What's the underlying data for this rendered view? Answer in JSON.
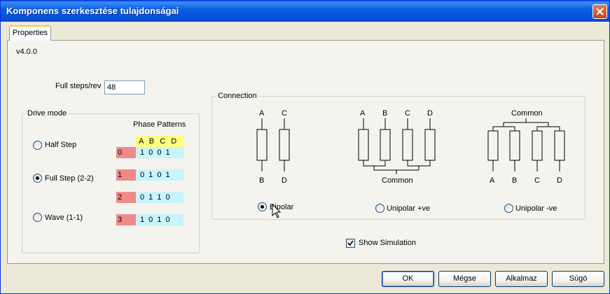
{
  "window": {
    "title": "Komponens szerkesztése tulajdonságai"
  },
  "tabs": [
    {
      "label": "Properties"
    }
  ],
  "version": "v4.0.0",
  "full_steps": {
    "label": "Full steps/rev",
    "value": "48"
  },
  "drive_mode": {
    "title": "Drive mode",
    "options": [
      {
        "label": "Half Step",
        "selected": false
      },
      {
        "label": "Full Step (2-2)",
        "selected": true
      },
      {
        "label": "Wave (1-1)",
        "selected": false
      }
    ],
    "phase_patterns": {
      "title": "Phase Patterns",
      "headers": [
        "A",
        "B",
        "C",
        "D"
      ],
      "rows": [
        {
          "index": "0",
          "bits": "1 0 0 1"
        },
        {
          "index": "1",
          "bits": "0 1 0 1"
        },
        {
          "index": "2",
          "bits": "0 1 1 0"
        },
        {
          "index": "3",
          "bits": "1 0 1 0"
        }
      ]
    }
  },
  "connection": {
    "title": "Connection",
    "bipolar": {
      "top": [
        "A",
        "C"
      ],
      "bottom": [
        "B",
        "D"
      ]
    },
    "unipolar_pos": {
      "top": [
        "A",
        "B",
        "C",
        "D"
      ],
      "bottom": "Common"
    },
    "unipolar_neg": {
      "top": "Common",
      "bottom": [
        "A",
        "B",
        "C",
        "D"
      ]
    },
    "options": [
      {
        "label": "Bipolar",
        "selected": true
      },
      {
        "label": "Unipolar +ve",
        "selected": false
      },
      {
        "label": "Unipolar -ve",
        "selected": false
      }
    ]
  },
  "show_simulation": {
    "label": "Show Simulation",
    "checked": true
  },
  "buttons": {
    "ok": "OK",
    "cancel": "Mégse",
    "apply": "Alkalmaz",
    "help": "Súgó"
  },
  "colors": {
    "titlebar": "#0451d8",
    "phase_index": "#f08a8a",
    "phase_bits": "#c8f4fb",
    "phase_header": "#ffff80"
  }
}
